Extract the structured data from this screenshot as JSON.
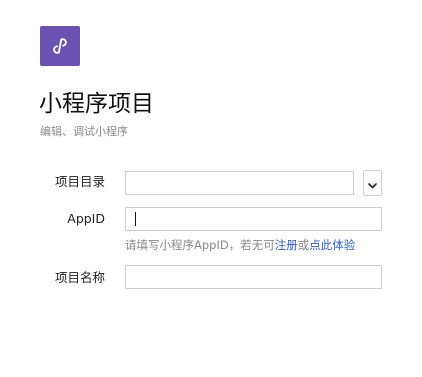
{
  "project": {
    "title": "小程序项目",
    "subtitle": "编辑、调试小程序",
    "logo_icon": "mini-program-link-icon",
    "logo_color": "#6a52b3"
  },
  "form": {
    "directory": {
      "label": "项目目录",
      "value": "",
      "dropdown_icon": "chevron-down-icon"
    },
    "appid": {
      "label": "AppID",
      "value": "",
      "hint_prefix": "请填写小程序AppID，若无可",
      "register_link": "注册",
      "hint_or": "或",
      "trial_link": "点此体验"
    },
    "name": {
      "label": "项目名称",
      "value": ""
    }
  },
  "colors": {
    "link": "#2f5fd0",
    "border": "#cfcfcf",
    "muted_text": "#888888"
  }
}
